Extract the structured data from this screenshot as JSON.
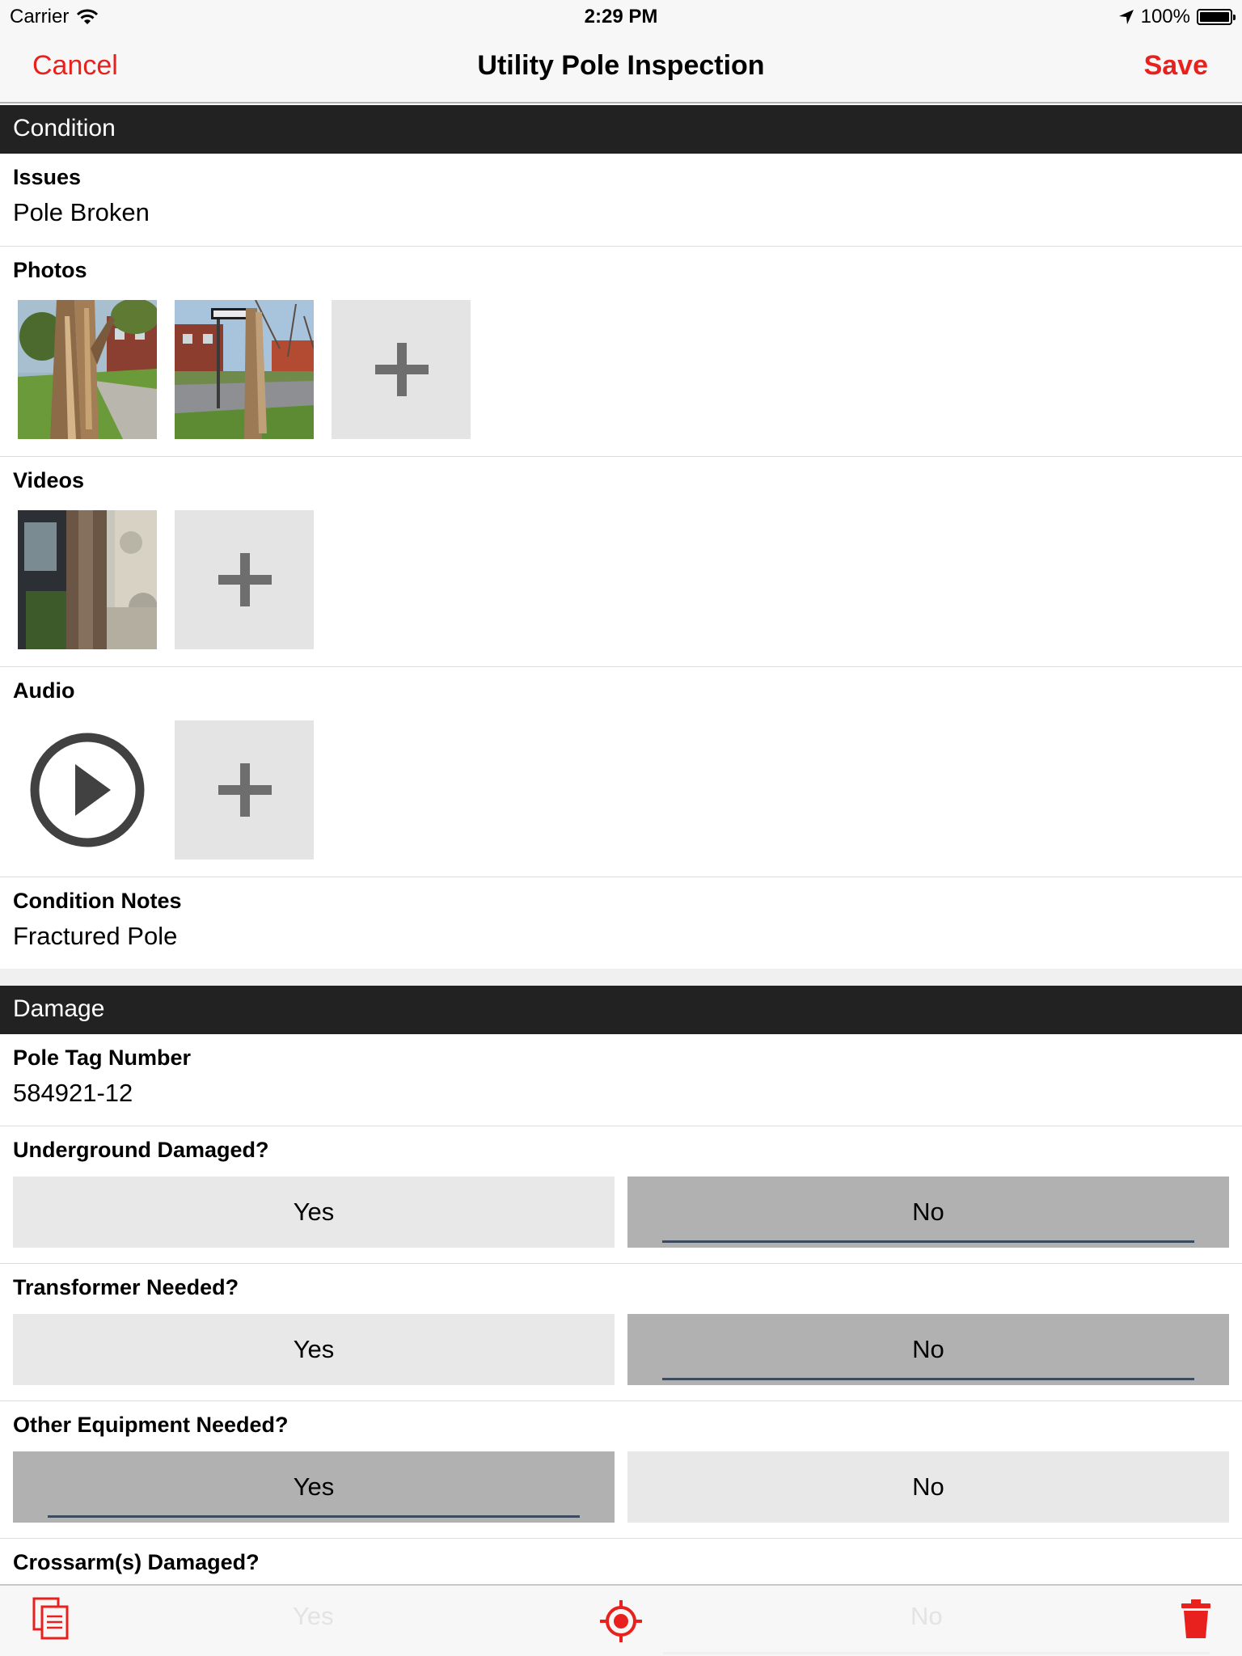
{
  "status_bar": {
    "carrier": "Carrier",
    "time": "2:29 PM",
    "battery": "100%"
  },
  "nav": {
    "cancel_label": "Cancel",
    "title": "Utility Pole Inspection",
    "save_label": "Save"
  },
  "condition": {
    "header": "Condition",
    "issues_label": "Issues",
    "issues_value": "Pole Broken",
    "photos_label": "Photos",
    "videos_label": "Videos",
    "audio_label": "Audio",
    "notes_label": "Condition Notes",
    "notes_value": "Fractured Pole"
  },
  "damage": {
    "header": "Damage",
    "pole_tag_label": "Pole Tag Number",
    "pole_tag_value": "584921-12",
    "questions": [
      {
        "label": "Underground Damaged?",
        "yes": "Yes",
        "no": "No",
        "selected": "No"
      },
      {
        "label": "Transformer Needed?",
        "yes": "Yes",
        "no": "No",
        "selected": "No"
      },
      {
        "label": "Other Equipment Needed?",
        "yes": "Yes",
        "no": "No",
        "selected": "Yes"
      },
      {
        "label": "Crossarm(s) Damaged?",
        "yes": "Yes",
        "no": "No",
        "selected": "No"
      }
    ]
  },
  "toolbar": {
    "icons": [
      "copy-document-icon",
      "locate-target-icon",
      "trash-icon"
    ]
  },
  "colors": {
    "accent": "#e8211e",
    "section_header": "#222222",
    "toggle_selected": "#b1b1b1",
    "toggle_unselected": "#e8e8e8"
  }
}
